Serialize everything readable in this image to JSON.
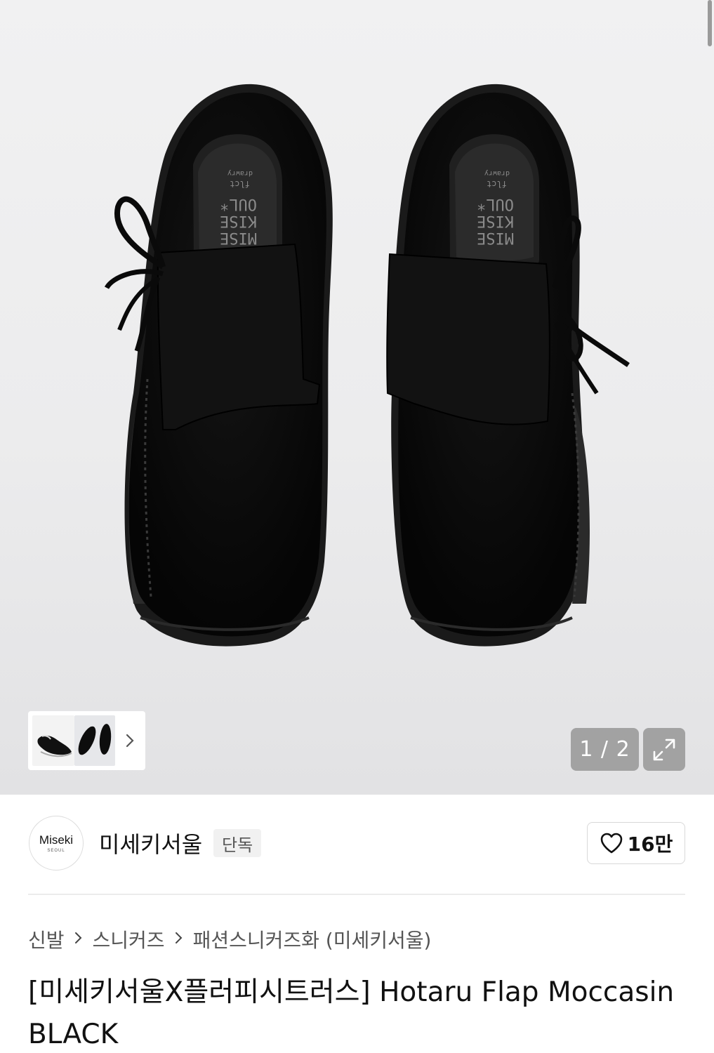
{
  "gallery": {
    "pager_text": "1 / 2",
    "insole_text": [
      "MISE",
      "KISE",
      "OUL*",
      "flct",
      "drawry"
    ],
    "thumbnails": [
      "shoe-side-thumbnail",
      "shoe-top-thumbnail"
    ],
    "next_icon": "chevron-right-icon",
    "fullscreen_icon": "expand-icon"
  },
  "brand": {
    "logo_main": "Miseki",
    "logo_sub": "SEOUL",
    "name": "미세키서울",
    "badge": "단독",
    "like_icon": "heart-icon",
    "like_count": "16만"
  },
  "breadcrumb": {
    "items": [
      "신발",
      "스니커즈",
      "패션스니커즈화 (미세키서울)"
    ],
    "separator_icon": "chevron-right-icon"
  },
  "product": {
    "title": "[미세키서울X플러피시트러스] Hotaru Flap Moccasin BLACK"
  },
  "colors": {
    "hero_bg": "#eeeeef",
    "suede": "#0b0b0b",
    "pager_bg": "#969696"
  }
}
